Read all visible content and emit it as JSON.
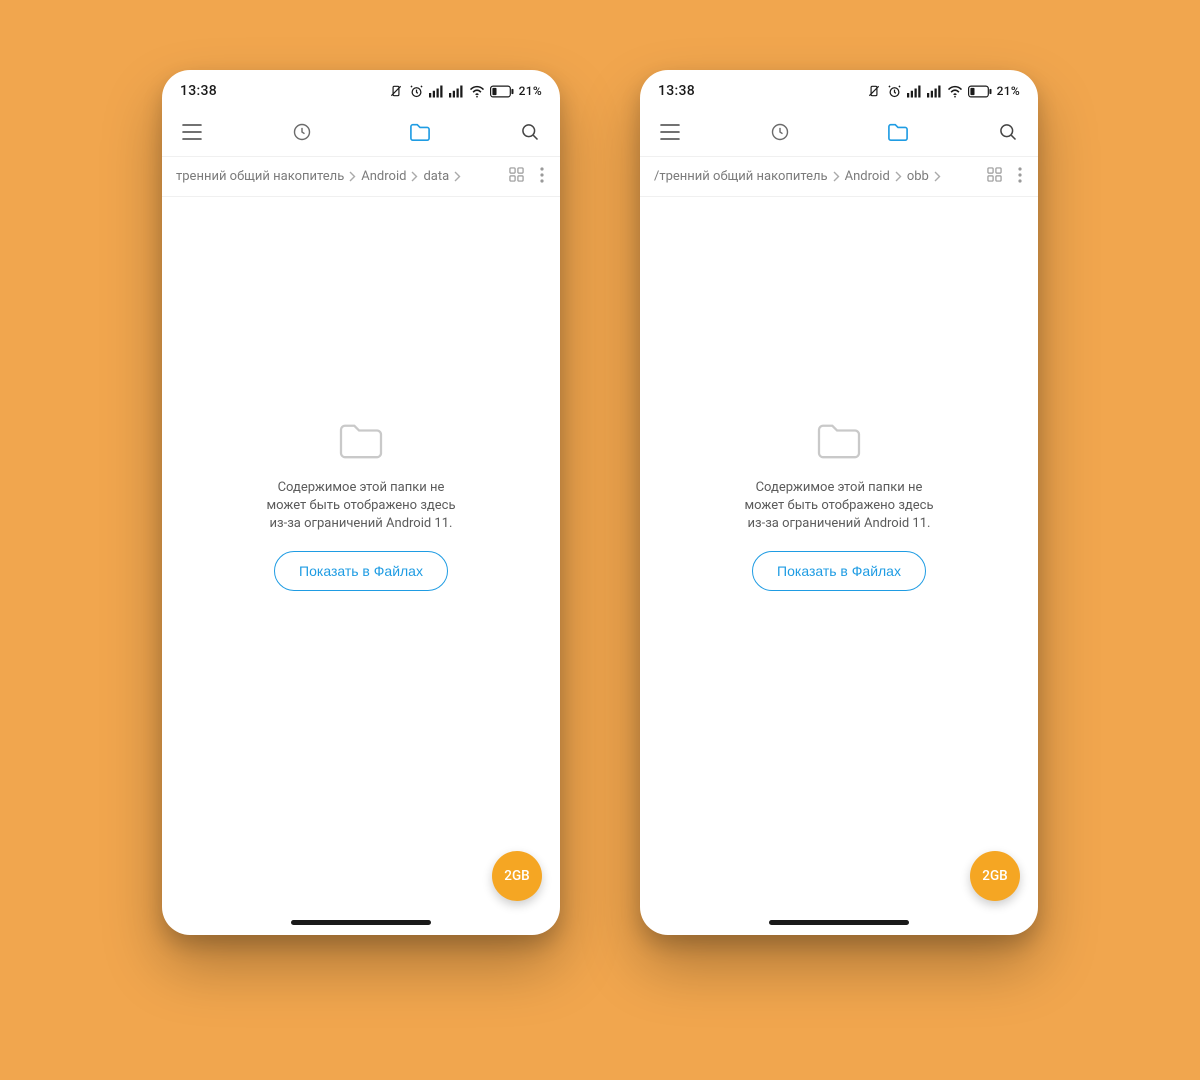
{
  "colors": {
    "accent": "#1f9ce3",
    "fab": "#f5a623"
  },
  "screens": [
    {
      "status": {
        "time": "13:38",
        "battery_text": "21%"
      },
      "breadcrumb": [
        "тренний общий накопитель",
        "Android",
        "data"
      ],
      "empty_message": "Содержимое этой папки не\nможет быть отображено здесь\nиз-за ограничений Android 11.",
      "show_button": "Показать в Файлах",
      "fab_label": "2GB"
    },
    {
      "status": {
        "time": "13:38",
        "battery_text": "21%"
      },
      "breadcrumb": [
        "/тренний общий накопитель",
        "Android",
        "obb"
      ],
      "empty_message": "Содержимое этой папки не\nможет быть отображено здесь\nиз-за ограничений Android 11.",
      "show_button": "Показать в Файлах",
      "fab_label": "2GB"
    }
  ]
}
